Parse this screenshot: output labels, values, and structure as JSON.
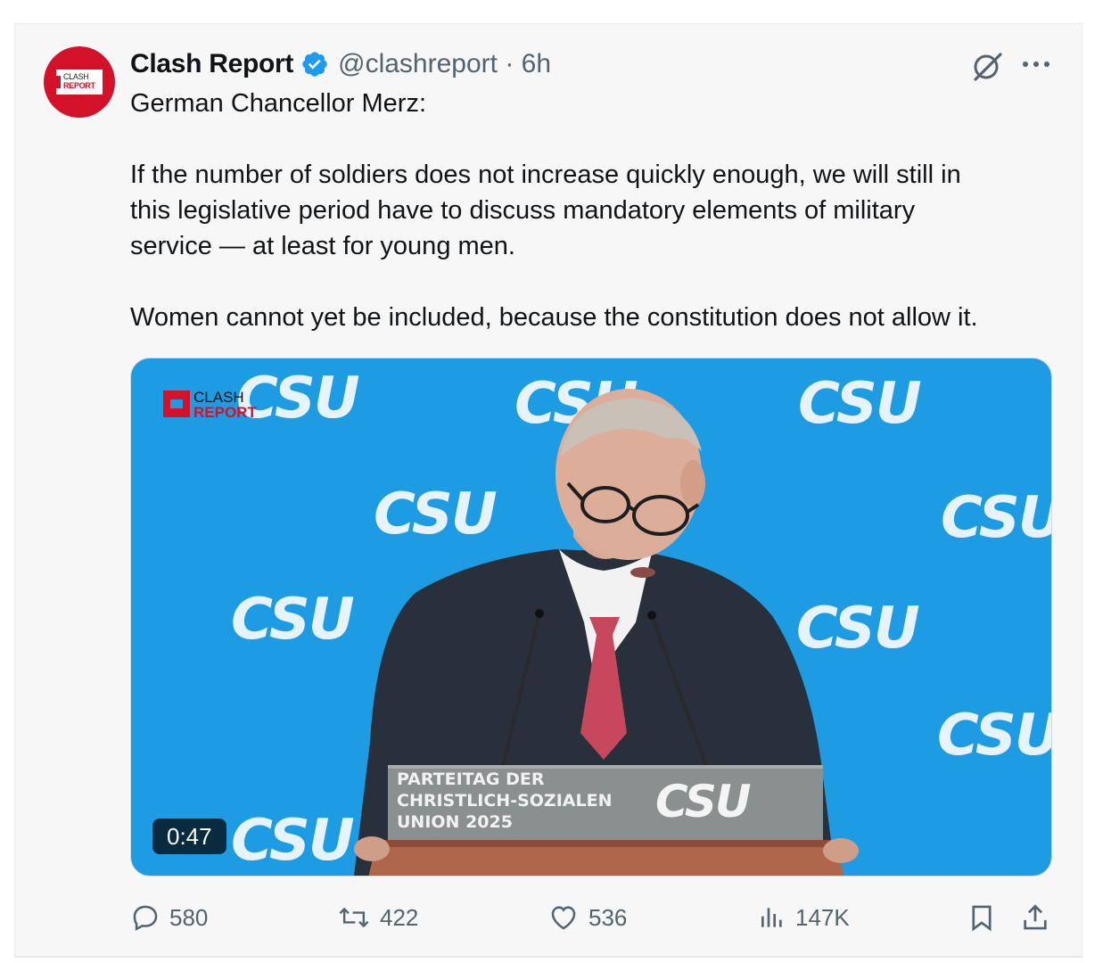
{
  "tweet": {
    "author_name": "Clash Report",
    "handle": "@clashreport",
    "separator": "·",
    "time": "6h",
    "avatar": {
      "line1": "CLASH",
      "line2": "REPORT"
    },
    "paragraphs": [
      "German Chancellor Merz:",
      "If the number of soldiers does not increase quickly enough, we will still in",
      "this legislative period have to discuss mandatory elements of military",
      "service — at least for young men.",
      "Women cannot yet be included, because the constitution does not allow it."
    ]
  },
  "media": {
    "duration": "0:47",
    "watermark_logo": {
      "line1": "CLASH",
      "line2": "REPORT"
    },
    "backdrop_text": "CSU",
    "podium_text": [
      "PARTEITAG DER",
      "CHRISTLICH-SOZIALEN",
      "UNION 2025"
    ],
    "podium_logo": "CSU"
  },
  "actions": {
    "replies": "580",
    "reposts": "422",
    "likes": "536",
    "views": "147K"
  },
  "icons": [
    "verified-icon",
    "grok-icon",
    "more-icon",
    "reply-icon",
    "repost-icon",
    "like-icon",
    "views-icon",
    "bookmark-icon",
    "share-icon"
  ],
  "colors": {
    "accent": "#1d9bf0",
    "brand_red": "#d3122a",
    "muted": "#536471",
    "csu_blue": "#1d9be3"
  }
}
